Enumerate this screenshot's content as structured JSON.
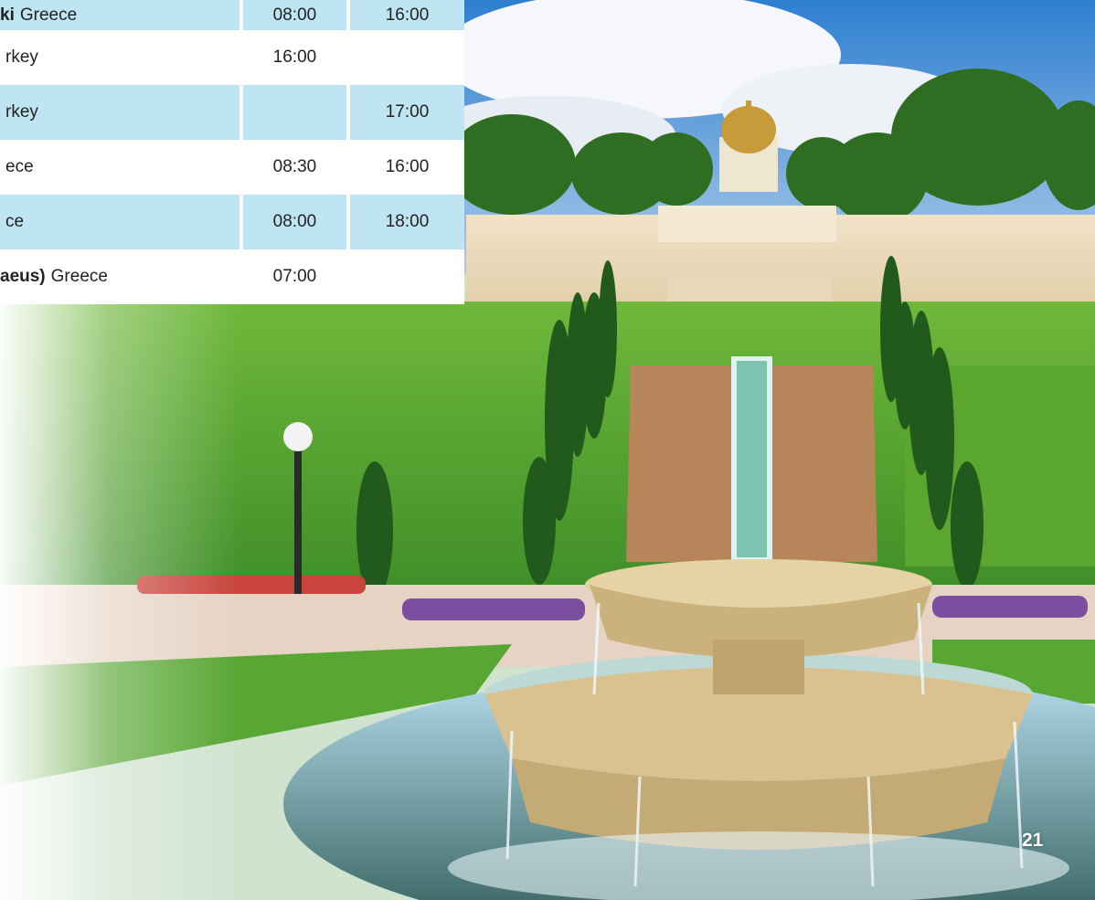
{
  "itinerary": [
    {
      "port_bold": "ki",
      "port": "Greece",
      "arrive": "08:00",
      "depart": "16:00",
      "shaded": true
    },
    {
      "port_bold": "",
      "port": "rkey",
      "arrive": "16:00",
      "depart": "",
      "shaded": false
    },
    {
      "port_bold": "",
      "port": "rkey",
      "arrive": "",
      "depart": "17:00",
      "shaded": true
    },
    {
      "port_bold": "",
      "port": "ece",
      "arrive": "08:30",
      "depart": "16:00",
      "shaded": false
    },
    {
      "port_bold": "",
      "port": "ce",
      "arrive": "08:00",
      "depart": "18:00",
      "shaded": true
    },
    {
      "port_bold": "aeus)",
      "port": "Greece",
      "arrive": "07:00",
      "depart": "",
      "shaded": false
    }
  ],
  "page_number": "21",
  "colors": {
    "row_shade": "#bfe4f2",
    "text": "#222222"
  }
}
